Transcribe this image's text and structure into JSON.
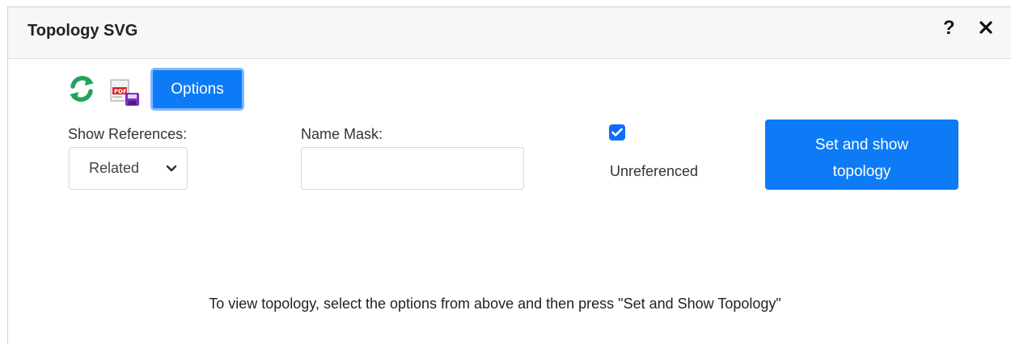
{
  "window": {
    "title": "Topology SVG",
    "help_label": "?",
    "close_label": "×"
  },
  "toolbar": {
    "refresh_icon": "refresh-icon",
    "export_icon": "pdf-save-icon",
    "options_label": "Options"
  },
  "form": {
    "show_references": {
      "label": "Show References:",
      "selected": "Related"
    },
    "name_mask": {
      "label": "Name Mask:",
      "value": "",
      "placeholder": ""
    },
    "unreferenced": {
      "label": "Unreferenced",
      "checked": true
    },
    "submit_label_line1": "Set and show",
    "submit_label_line2": "topology"
  },
  "hint": "To view topology, select the options from above and then press \"Set and Show Topology\"",
  "colors": {
    "primary": "#0d7bf5",
    "header_bg": "#f7f7f7",
    "refresh_green": "#22a45d",
    "pdf_red": "#d0262f",
    "disk_purple": "#7b2fbe"
  }
}
